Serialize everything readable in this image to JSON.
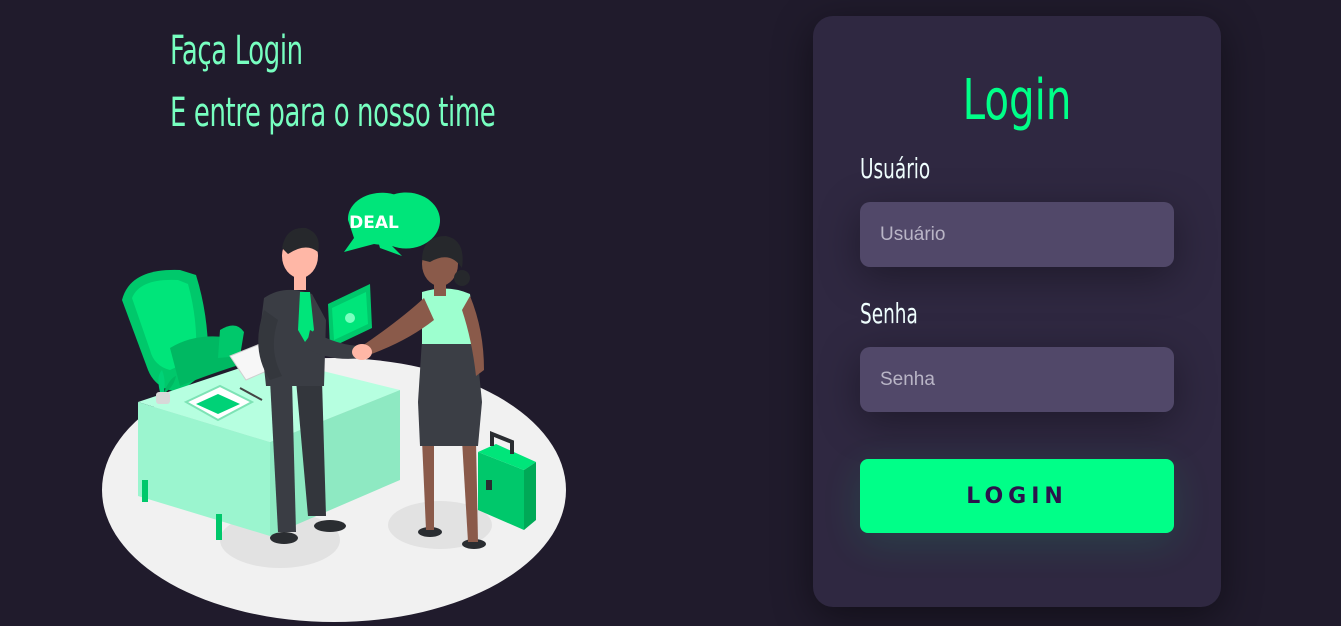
{
  "hero": {
    "line1": "Faça Login",
    "line2": "E entre para o nosso time"
  },
  "illustration": {
    "speech_bubble_text": "DEAL"
  },
  "login_card": {
    "title": "Login",
    "username": {
      "label": "Usuário",
      "placeholder": "Usuário",
      "value": ""
    },
    "password": {
      "label": "Senha",
      "placeholder": "Senha",
      "value": ""
    },
    "submit_label": "LOGIN"
  },
  "colors": {
    "background": "#201b2c",
    "card": "#2f2841",
    "input": "#514869",
    "accent": "#00ff88",
    "headline": "#77ffc0",
    "button_text": "#2b134b"
  }
}
